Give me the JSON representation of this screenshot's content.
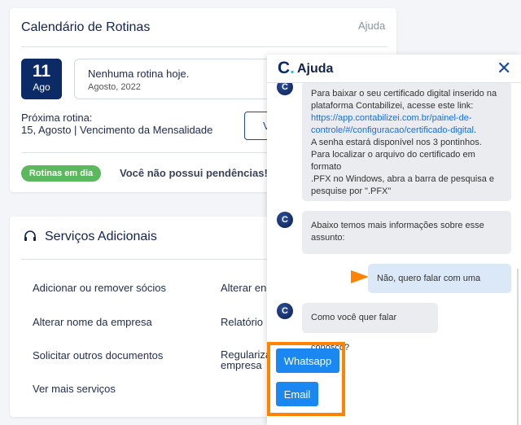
{
  "calendar": {
    "title": "Calendário de Rotinas",
    "help_link": "Ajuda",
    "day": "11",
    "month": "Ago",
    "no_routine": "Nenhuma rotina hoje.",
    "period": "Agosto, 2022",
    "next_label": "Próxima rotina:",
    "next_value": "15, Agosto | Vencimento da Mensalidade",
    "button_partial": "V",
    "badge": "Rotinas em dia",
    "status": "Você não possui pendências!"
  },
  "services": {
    "title": "Serviços Adicionais",
    "col1": [
      "Adicionar ou remover sócios",
      "Alterar nome da empresa",
      "Solicitar outros documentos",
      "Ver mais serviços"
    ],
    "col2": [
      "Alterar en",
      "Relatório",
      "Regulariza",
      "empresa"
    ]
  },
  "chat": {
    "title": "Ajuda",
    "logo": "C.",
    "msg1": {
      "line1": "Para baixar o seu certificado digital inserido na",
      "line2": "plataforma Contabilizei, acesse este link:",
      "link1": "https://app.contabilizei.com.br/painel-de-",
      "link2": "controle/#/configuracao/certificado-digital",
      "line3": "A senha estará disponível nos 3 pontinhos.",
      "line4": "Para localizar o arquivo do certificado em formato",
      "line5": ".PFX no Windows, abra a barra de pesquisa e",
      "line6": "pesquise por \".PFX\""
    },
    "msg2": {
      "line1": "Abaixo temos mais informações sobre esse",
      "line2": "assunto:"
    },
    "user_msg": "Não, quero falar com uma pessoa",
    "msg3": "Como você quer falar conosco?",
    "options": [
      "Whatsapp",
      "Email"
    ]
  },
  "colors": {
    "navy": "#0b2a66",
    "green": "#5cb85c",
    "button_blue": "#1a88f0",
    "highlight_orange": "#ff8200",
    "user_bubble": "#dbe8f7"
  }
}
